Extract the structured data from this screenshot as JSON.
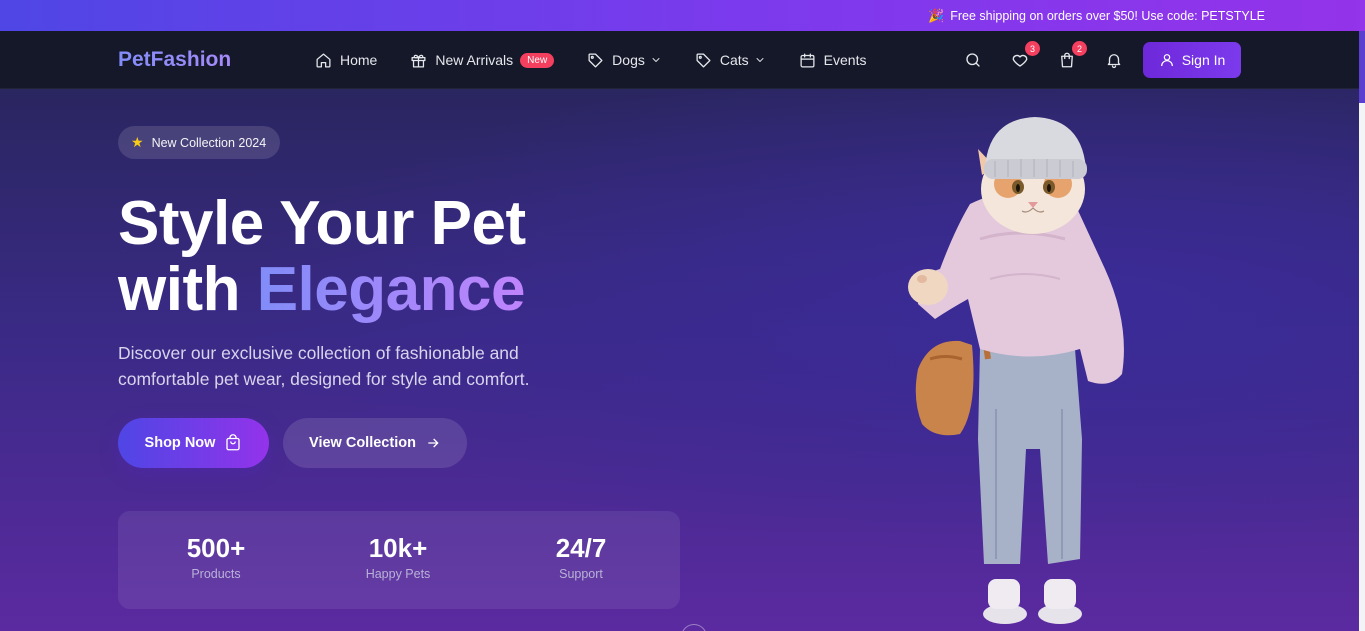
{
  "announcement": {
    "emoji": "🎉",
    "text": "Free shipping on orders over $50! Use code: PETSTYLE"
  },
  "brand": "PetFashion",
  "nav": {
    "home": "Home",
    "new_arrivals": "New Arrivals",
    "new_badge": "New",
    "dogs": "Dogs",
    "cats": "Cats",
    "events": "Events"
  },
  "header_icons": {
    "wishlist_count": "3",
    "cart_count": "2"
  },
  "signin": "Sign In",
  "hero": {
    "pill": "New Collection 2024",
    "headline_line1": "Style Your Pet",
    "headline_line2_plain": "with ",
    "headline_line2_accent": "Elegance",
    "subtitle": "Discover our exclusive collection of fashionable and comfortable pet wear, designed for style and comfort.",
    "shop_now": "Shop Now",
    "view_collection": "View Collection"
  },
  "stats": [
    {
      "value": "500+",
      "label": "Products"
    },
    {
      "value": "10k+",
      "label": "Happy Pets"
    },
    {
      "value": "24/7",
      "label": "Support"
    }
  ],
  "colors": {
    "accent": "#7c3aed",
    "badge": "#f43f5e",
    "nav_bg": "#141829"
  }
}
